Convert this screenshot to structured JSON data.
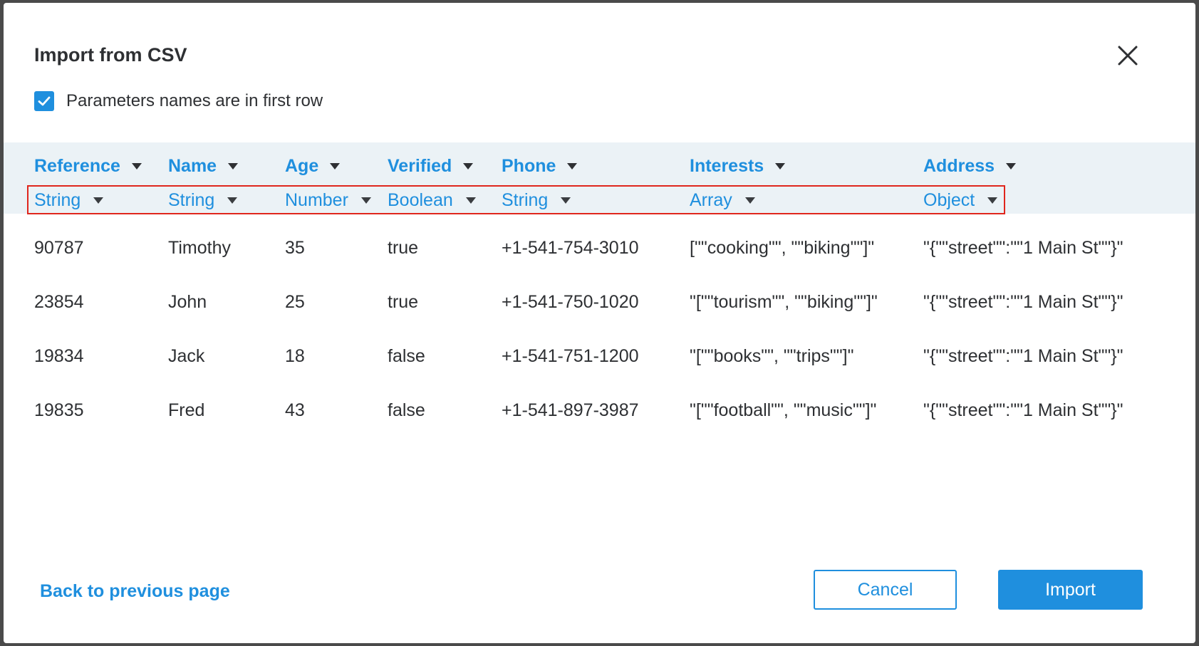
{
  "dialog": {
    "title": "Import from CSV",
    "checkbox_label": "Parameters names are in first row",
    "checkbox_checked": true
  },
  "columns": [
    {
      "name": "Reference",
      "type": "String"
    },
    {
      "name": "Name",
      "type": "String"
    },
    {
      "name": "Age",
      "type": "Number"
    },
    {
      "name": "Verified",
      "type": "Boolean"
    },
    {
      "name": "Phone",
      "type": "String"
    },
    {
      "name": "Interests",
      "type": "Array"
    },
    {
      "name": "Address",
      "type": "Object"
    }
  ],
  "rows": [
    [
      "90787",
      "Timothy",
      "35",
      "true",
      "+1-541-754-3010",
      "[\"\"cooking\"\", \"\"biking\"\"]\"",
      "\"{\"\"street\"\":\"\"1 Main St\"\"}\""
    ],
    [
      "23854",
      "John",
      "25",
      "true",
      "+1-541-750-1020",
      "\"[\"\"tourism\"\", \"\"biking\"\"]\"",
      "\"{\"\"street\"\":\"\"1 Main St\"\"}\""
    ],
    [
      "19834",
      "Jack",
      "18",
      "false",
      "+1-541-751-1200",
      "\"[\"\"books\"\", \"\"trips\"\"]\"",
      "\"{\"\"street\"\":\"\"1 Main St\"\"}\""
    ],
    [
      "19835",
      "Fred",
      "43",
      "false",
      "+1-541-897-3987",
      "\"[\"\"football\"\", \"\"music\"\"]\"",
      "\"{\"\"street\"\":\"\"1 Main St\"\"}\""
    ]
  ],
  "footer": {
    "back_link": "Back to previous page",
    "cancel_label": "Cancel",
    "import_label": "Import"
  },
  "colors": {
    "accent": "#1f8fde",
    "header_band": "#ebf2f6",
    "highlight_border": "#e0261d",
    "text": "#2e3033"
  }
}
